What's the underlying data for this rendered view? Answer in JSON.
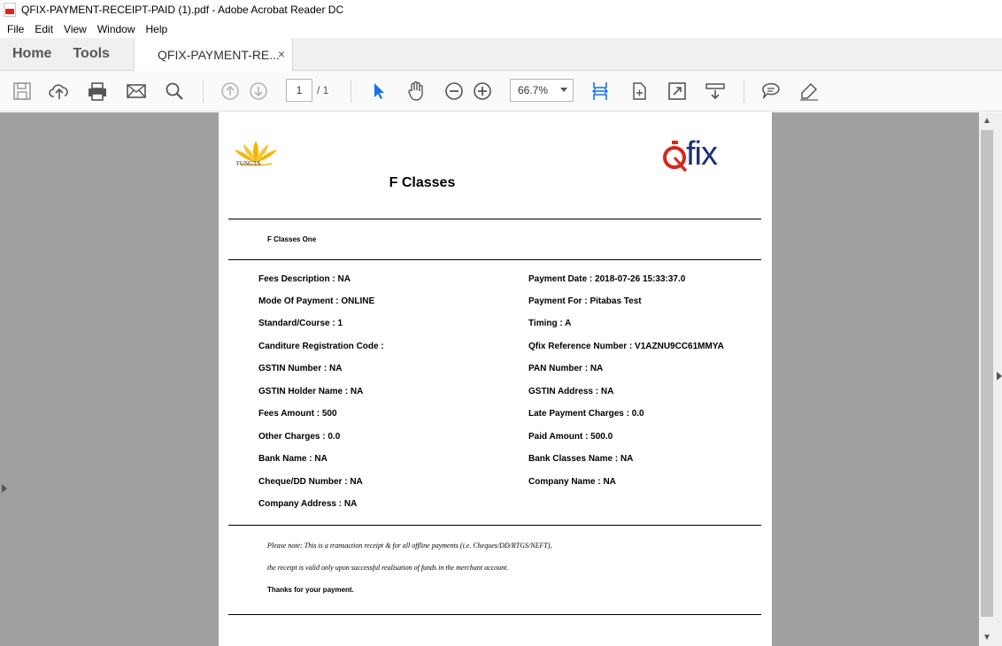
{
  "window": {
    "title": "QFIX-PAYMENT-RECEIPT-PAID (1).pdf - Adobe Acrobat Reader DC"
  },
  "menu": [
    "File",
    "Edit",
    "View",
    "Window",
    "Help"
  ],
  "tabs": {
    "home": "Home",
    "tools": "Tools",
    "document": "QFIX-PAYMENT-RE...",
    "close": "×"
  },
  "toolbar": {
    "page_current": "1",
    "page_total": "/ 1",
    "zoom": "66.7%"
  },
  "colors": {
    "accent_blue": "#1473e6",
    "viewer_bg": "#a0a0a0",
    "qfix_red": "#d9261c",
    "qfix_navy": "#1d2f6f",
    "lotus_yellow": "#f5b400"
  },
  "receipt": {
    "logo_left_caption": "FUNGTA",
    "logo_right_text": "fix",
    "school_name": "F Classes",
    "sub_name": "F Classes One",
    "left_fields": [
      "Fees Description : NA",
      "Mode Of Payment : ONLINE",
      "Standard/Course : 1",
      "Canditure Registration Code :",
      "GSTIN Number : NA",
      "GSTIN Holder Name : NA",
      "Fees Amount : 500",
      "Other Charges : 0.0",
      "Bank Name : NA",
      "Cheque/DD Number : NA",
      "Company Address : NA"
    ],
    "right_fields": [
      "Payment Date : 2018-07-26 15:33:37.0",
      "Payment For : Pitabas Test",
      "Timing : A",
      "Qfix Reference Number : V1AZNU9CC61MMYA",
      "PAN Number : NA",
      "GSTIN Address : NA",
      "Late Payment Charges : 0.0",
      "Paid Amount : 500.0",
      "Bank Classes Name : NA",
      "Company Name : NA"
    ],
    "note_line1": "Please note: This is a transaction receipt & for all offline payments (i.e. Cheques/DD/RTGS/NEFT),",
    "note_line2": "the receipt is valid only upon successful realisation of funds in the merchant account.",
    "thanks": "Thanks for your payment."
  }
}
